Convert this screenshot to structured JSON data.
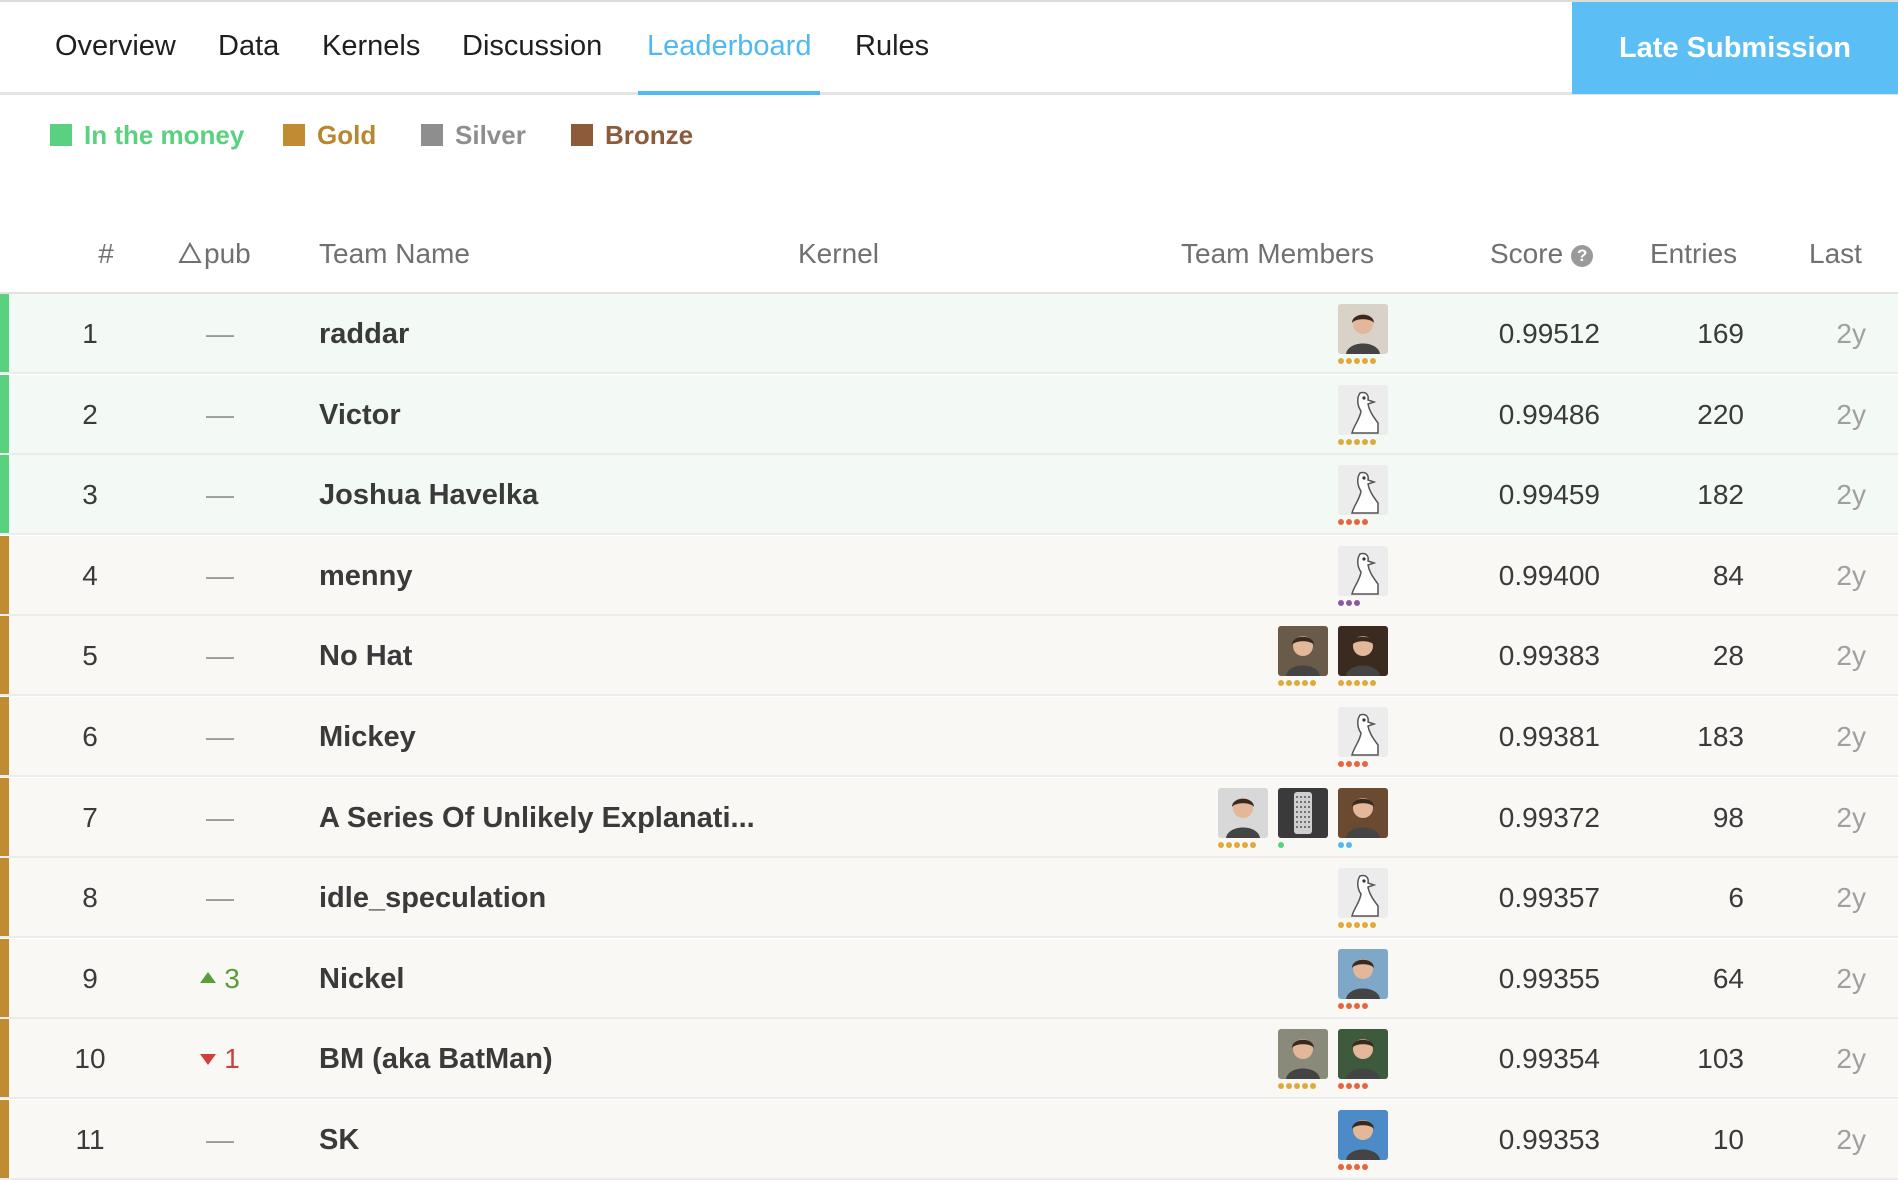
{
  "nav": {
    "tabs": [
      {
        "label": "Overview",
        "active": false
      },
      {
        "label": "Data",
        "active": false
      },
      {
        "label": "Kernels",
        "active": false
      },
      {
        "label": "Discussion",
        "active": false
      },
      {
        "label": "Leaderboard",
        "active": true
      },
      {
        "label": "Rules",
        "active": false
      }
    ],
    "late_submission_label": "Late Submission"
  },
  "legend": [
    {
      "label": "In the money",
      "color": "#59d17f"
    },
    {
      "label": "Gold",
      "color": "#c08b31"
    },
    {
      "label": "Silver",
      "color": "#8e8e8e"
    },
    {
      "label": "Bronze",
      "color": "#8e5b3a"
    }
  ],
  "table": {
    "headers": {
      "rank": "#",
      "delta": "pub",
      "team": "Team Name",
      "kernel": "Kernel",
      "members": "Team Members",
      "score": "Score",
      "entries": "Entries",
      "last": "Last"
    },
    "rows": [
      {
        "rank": "1",
        "delta": "—",
        "delta_dir": "none",
        "team": "raddar",
        "score": "0.99512",
        "entries": "169",
        "last": "2y",
        "tier": "money",
        "members": [
          {
            "avatar": "person-icon",
            "bg": "#d9d2c8",
            "dots": [
              "#e0a93b",
              "#e0a93b",
              "#e0a93b",
              "#e0a93b",
              "#e0a93b"
            ]
          }
        ]
      },
      {
        "rank": "2",
        "delta": "—",
        "delta_dir": "none",
        "team": "Victor",
        "score": "0.99486",
        "entries": "220",
        "last": "2y",
        "tier": "money",
        "members": [
          {
            "avatar": "goose-icon",
            "bg": "#ececec",
            "dots": [
              "#e0a93b",
              "#e0a93b",
              "#e0a93b",
              "#e0a93b",
              "#e0a93b"
            ]
          }
        ]
      },
      {
        "rank": "3",
        "delta": "—",
        "delta_dir": "none",
        "team": "Joshua Havelka",
        "score": "0.99459",
        "entries": "182",
        "last": "2y",
        "tier": "money",
        "members": [
          {
            "avatar": "goose-icon",
            "bg": "#ececec",
            "dots": [
              "#e8643c",
              "#e8643c",
              "#e8643c",
              "#e8643c"
            ]
          }
        ]
      },
      {
        "rank": "4",
        "delta": "—",
        "delta_dir": "none",
        "team": "menny",
        "score": "0.99400",
        "entries": "84",
        "last": "2y",
        "tier": "gold",
        "members": [
          {
            "avatar": "goose-icon",
            "bg": "#ececec",
            "dots": [
              "#8a5aa8",
              "#8a5aa8",
              "#8a5aa8"
            ]
          }
        ]
      },
      {
        "rank": "5",
        "delta": "—",
        "delta_dir": "none",
        "team": "No Hat",
        "score": "0.99383",
        "entries": "28",
        "last": "2y",
        "tier": "gold",
        "members": [
          {
            "avatar": "person-icon",
            "bg": "#3a2a20",
            "dots": [
              "#e0a93b",
              "#e0a93b",
              "#e0a93b",
              "#e0a93b",
              "#e0a93b"
            ]
          },
          {
            "avatar": "person-icon",
            "bg": "#6a5a4a",
            "dots": [
              "#e0a93b",
              "#e0a93b",
              "#e0a93b",
              "#e0a93b",
              "#e0a93b"
            ]
          }
        ]
      },
      {
        "rank": "6",
        "delta": "—",
        "delta_dir": "none",
        "team": "Mickey",
        "score": "0.99381",
        "entries": "183",
        "last": "2y",
        "tier": "gold",
        "members": [
          {
            "avatar": "goose-icon",
            "bg": "#ececec",
            "dots": [
              "#e8643c",
              "#e8643c",
              "#e8643c",
              "#e8643c"
            ]
          }
        ]
      },
      {
        "rank": "7",
        "delta": "—",
        "delta_dir": "none",
        "team": "A Series Of Unlikely Explanati...",
        "score": "0.99372",
        "entries": "98",
        "last": "2y",
        "tier": "gold",
        "members": [
          {
            "avatar": "person-icon",
            "bg": "#6a4a30",
            "dots": [
              "#4fb9f2",
              "#4fb9f2"
            ]
          },
          {
            "avatar": "grater-icon",
            "bg": "#3a3a3a",
            "dots": [
              "#59d17f"
            ]
          },
          {
            "avatar": "person-icon",
            "bg": "#d8d8d8",
            "dots": [
              "#e0a93b",
              "#e0a93b",
              "#e0a93b",
              "#e0a93b",
              "#e0a93b"
            ]
          }
        ]
      },
      {
        "rank": "8",
        "delta": "—",
        "delta_dir": "none",
        "team": "idle_speculation",
        "score": "0.99357",
        "entries": "6",
        "last": "2y",
        "tier": "gold",
        "members": [
          {
            "avatar": "goose-icon",
            "bg": "#ececec",
            "dots": [
              "#e0a93b",
              "#e0a93b",
              "#e0a93b",
              "#e0a93b",
              "#e0a93b"
            ]
          }
        ]
      },
      {
        "rank": "9",
        "delta": "3",
        "delta_dir": "up",
        "team": "Nickel",
        "score": "0.99355",
        "entries": "64",
        "last": "2y",
        "tier": "gold",
        "members": [
          {
            "avatar": "person-icon",
            "bg": "#7fa8c8",
            "dots": [
              "#e8643c",
              "#e8643c",
              "#e8643c",
              "#e8643c"
            ]
          }
        ]
      },
      {
        "rank": "10",
        "delta": "1",
        "delta_dir": "down",
        "team": "BM (aka BatMan)",
        "score": "0.99354",
        "entries": "103",
        "last": "2y",
        "tier": "gold",
        "members": [
          {
            "avatar": "person-icon",
            "bg": "#3d5a3d",
            "dots": [
              "#e8643c",
              "#e8643c",
              "#e8643c",
              "#e8643c"
            ]
          },
          {
            "avatar": "person-icon",
            "bg": "#8a8a7a",
            "dots": [
              "#e0a93b",
              "#e0a93b",
              "#e0a93b",
              "#e0a93b",
              "#e0a93b"
            ]
          }
        ]
      },
      {
        "rank": "11",
        "delta": "—",
        "delta_dir": "none",
        "team": "SK",
        "score": "0.99353",
        "entries": "10",
        "last": "2y",
        "tier": "gold",
        "members": [
          {
            "avatar": "person-icon",
            "bg": "#4c8ac8",
            "dots": [
              "#e8643c",
              "#e8643c",
              "#e8643c",
              "#e8643c"
            ]
          }
        ]
      }
    ]
  },
  "colors": {
    "accent": "#4fb9f2",
    "money_row_bg": "#f3faf5",
    "gold_row_bg": "#f9f8f5",
    "money_bar": "#59d17f",
    "gold_bar": "#c08b31"
  }
}
